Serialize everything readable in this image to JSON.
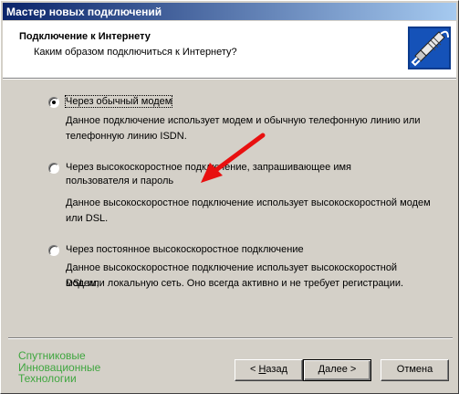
{
  "window": {
    "title": "Мастер новых подключений"
  },
  "header": {
    "title": "Подключение к Интернету",
    "subtitle": "Каким образом подключиться к Интернету?",
    "icon": "network-cable-icon"
  },
  "options": [
    {
      "label": "Через обычный модем",
      "description_line1": "Данное подключение использует модем и обычную телефонную линию или",
      "description_line2": "телефонную линию ISDN.",
      "selected": true
    },
    {
      "label_line1": "Через высокоскоростное подключение, запрашивающее имя",
      "label_line2": "пользователя и пароль",
      "description_line1": "Данное высокоскоростное подключение использует высокоскоростной модем",
      "description_line2": "или DSL.",
      "selected": false
    },
    {
      "label": "Через постоянное высокоскоростное подключение",
      "description_line1": "Данное высокоскоростное подключение использует высокоскоростной модем,",
      "description_line2": "DSL или локальную сеть. Оно всегда активно и не требует регистрации.",
      "selected": false
    }
  ],
  "branding": {
    "line1": "Спутниковые",
    "line2": "Инновационные",
    "line3": "Технологии",
    "color": "#3fa63f"
  },
  "buttons": {
    "back": {
      "prefix": "< ",
      "accel": "Н",
      "rest": "азад"
    },
    "next": {
      "accel": "Д",
      "rest": "алее >"
    },
    "cancel": "Отмена"
  },
  "annotation": {
    "arrow_color": "#e81010"
  }
}
